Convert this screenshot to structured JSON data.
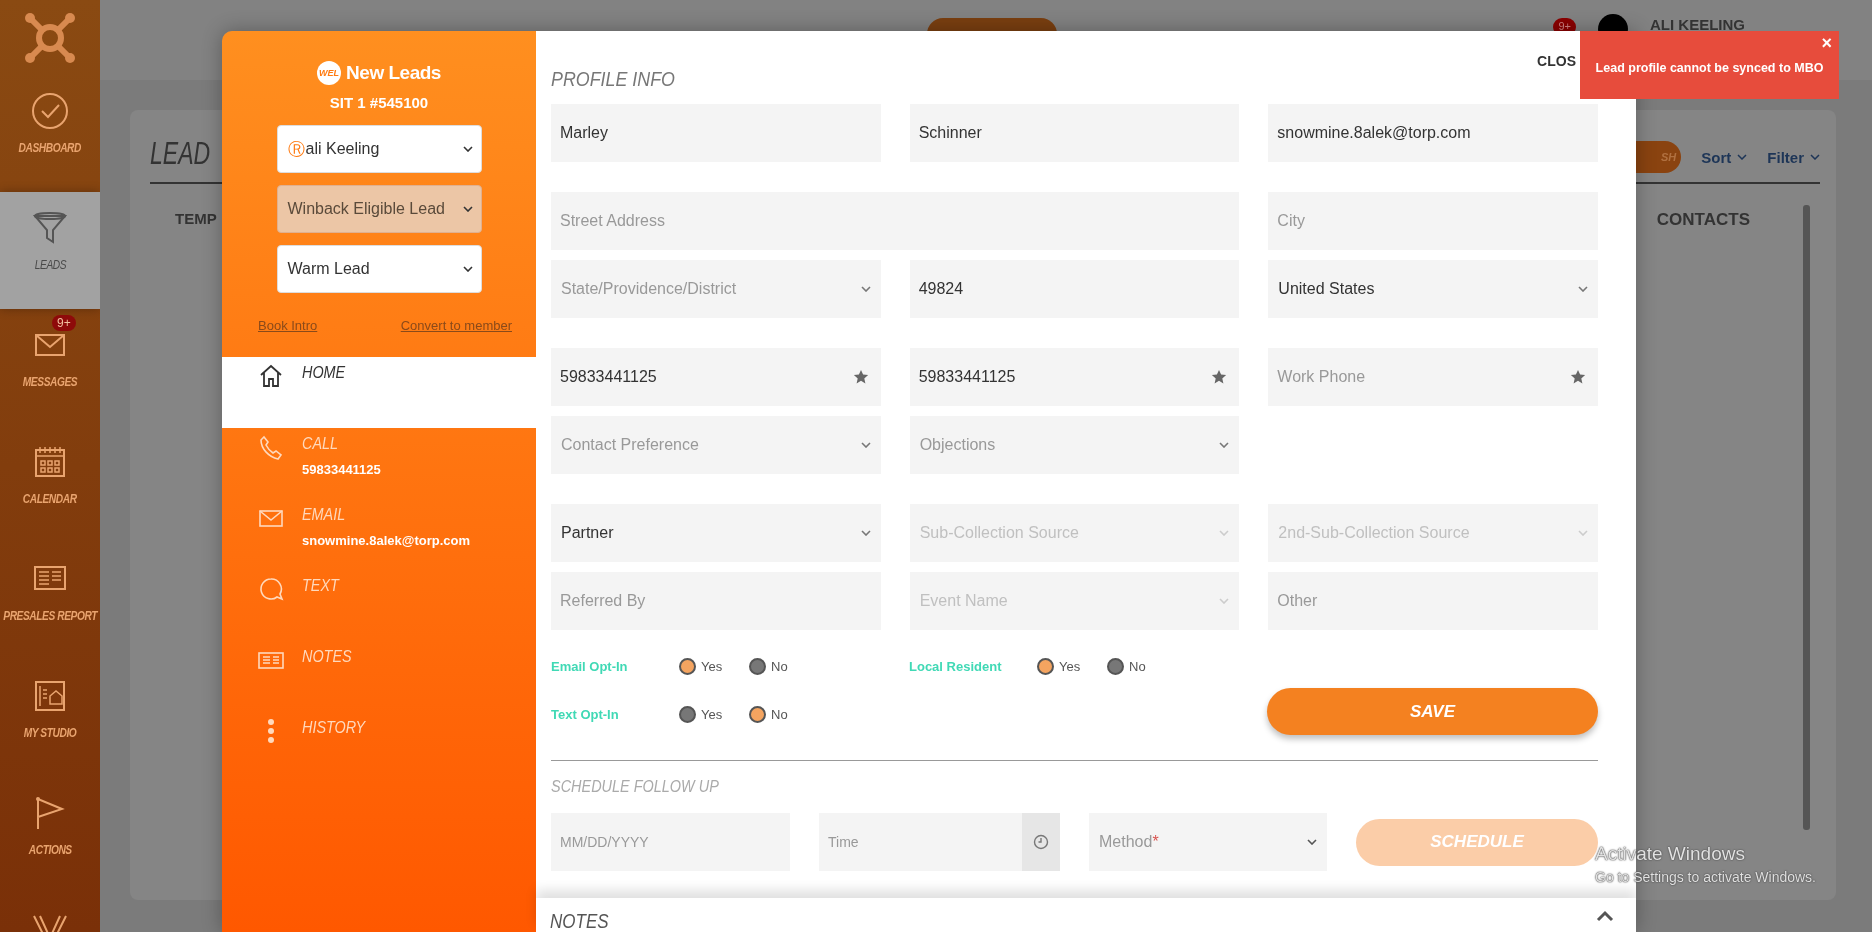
{
  "app_sidebar": {
    "items": [
      {
        "label": "DASHBOARD",
        "selected": false
      },
      {
        "label": "LEADS",
        "selected": true
      },
      {
        "label": "MESSAGES",
        "selected": false,
        "badge": "9+"
      },
      {
        "label": "CALENDAR",
        "selected": false
      },
      {
        "label": "PRESALES REPORT",
        "selected": false
      },
      {
        "label": "MY STUDIO",
        "selected": false
      },
      {
        "label": "ACTIONS",
        "selected": false
      },
      {
        "selected": false
      }
    ]
  },
  "header": {
    "notification_badge": "9+",
    "user_name": "ALI KEELING"
  },
  "leads_card": {
    "title": "LEAD",
    "search_button": "SH",
    "sort": "Sort",
    "filter": "Filter",
    "columns": [
      "TEMP",
      "CONTACTS"
    ]
  },
  "lead_modal": {
    "sidebar": {
      "logo_badge": "WEL",
      "title": "New Leads",
      "subtitle": "SIT 1 #545100",
      "selects": [
        {
          "kind": "owner",
          "prefix": "Ⓡ",
          "value": "ali Keeling"
        },
        {
          "kind": "status",
          "value": "Winback Eligible Lead"
        },
        {
          "kind": "plain",
          "value": "Warm Lead"
        }
      ],
      "links": [
        "Book Intro",
        "Convert to member"
      ],
      "nav": [
        {
          "label": "HOME",
          "selected": true
        },
        {
          "label": "CALL",
          "detail": "59833441125",
          "selected": false
        },
        {
          "label": "EMAIL",
          "detail": "snowmine.8alek@torp.com",
          "selected": false
        },
        {
          "label": "TEXT",
          "selected": false
        },
        {
          "label": "NOTES",
          "selected": false
        },
        {
          "label": "HISTORY",
          "selected": false
        }
      ]
    },
    "close": "CLOS",
    "profile_title": "PROFILE INFO",
    "field_rows": [
      [
        {
          "kind": "input",
          "value": "Marley"
        },
        {
          "kind": "input",
          "value": "Schinner"
        },
        {
          "kind": "input",
          "value": "snowmine.8alek@torp.com"
        }
      ],
      [
        {
          "kind": "input",
          "placeholder": "Street Address",
          "wide": true
        },
        {
          "kind": "input",
          "placeholder": "City"
        }
      ],
      [
        {
          "kind": "select",
          "placeholder": "State/Providence/District",
          "disabled": false
        },
        {
          "kind": "input",
          "value": "49824"
        },
        {
          "kind": "select",
          "value": "United States",
          "disabled": false
        }
      ],
      [
        {
          "kind": "phone",
          "value": "59833441125"
        },
        {
          "kind": "phone",
          "value": "59833441125"
        },
        {
          "kind": "phone",
          "placeholder": "Work Phone"
        }
      ],
      [
        {
          "kind": "select",
          "placeholder": "Contact Preference",
          "disabled": false
        },
        {
          "kind": "select",
          "placeholder": "Objections",
          "disabled": false
        }
      ],
      [
        {
          "kind": "select",
          "value": "Partner",
          "disabled": false
        },
        {
          "kind": "select",
          "placeholder": "Sub-Collection Source",
          "disabled": true
        },
        {
          "kind": "select",
          "placeholder": "2nd-Sub-Collection Source",
          "disabled": true
        }
      ],
      [
        {
          "kind": "input",
          "placeholder": "Referred By"
        },
        {
          "kind": "select",
          "placeholder": "Event Name",
          "disabled": true
        },
        {
          "kind": "input",
          "placeholder": "Other"
        }
      ]
    ],
    "opt_ins": [
      {
        "label": "Email Opt-In",
        "options": [
          {
            "label": "Yes",
            "selected": true
          },
          {
            "label": "No",
            "selected": false
          }
        ]
      },
      {
        "label": "Local Resident",
        "options": [
          {
            "label": "Yes",
            "selected": true
          },
          {
            "label": "No",
            "selected": false
          }
        ]
      },
      {
        "label": "Text Opt-In",
        "options": [
          {
            "label": "Yes",
            "selected": false
          },
          {
            "label": "No",
            "selected": true
          }
        ]
      }
    ],
    "save_button": "SAVE",
    "schedule": {
      "title": "SCHEDULE FOLLOW UP",
      "date_placeholder": "MM/DD/YYYY",
      "time_placeholder": "Time",
      "method_placeholder": "Method",
      "required_mark": "*",
      "button": "SCHEDULE",
      "button_disabled": true
    },
    "notes_title": "NOTES"
  },
  "toast": {
    "message": "Lead profile cannot be synced to MBO",
    "close_label": "×"
  },
  "os_notice": {
    "title": "Activate Windows",
    "subtitle": "Go to Settings to activate Windows."
  }
}
